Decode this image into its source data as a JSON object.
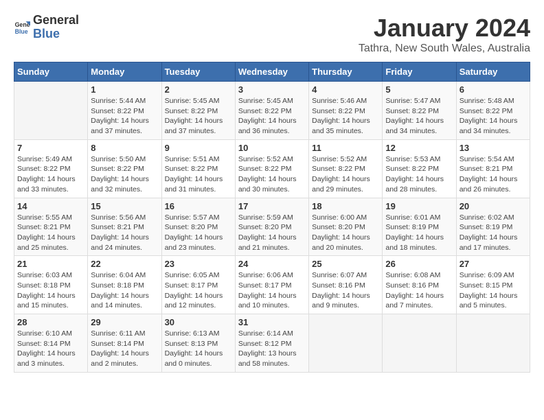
{
  "logo": {
    "line1": "General",
    "line2": "Blue"
  },
  "title": "January 2024",
  "subtitle": "Tathra, New South Wales, Australia",
  "days_of_week": [
    "Sunday",
    "Monday",
    "Tuesday",
    "Wednesday",
    "Thursday",
    "Friday",
    "Saturday"
  ],
  "weeks": [
    [
      {
        "day": "",
        "info": ""
      },
      {
        "day": "1",
        "info": "Sunrise: 5:44 AM\nSunset: 8:22 PM\nDaylight: 14 hours\nand 37 minutes."
      },
      {
        "day": "2",
        "info": "Sunrise: 5:45 AM\nSunset: 8:22 PM\nDaylight: 14 hours\nand 37 minutes."
      },
      {
        "day": "3",
        "info": "Sunrise: 5:45 AM\nSunset: 8:22 PM\nDaylight: 14 hours\nand 36 minutes."
      },
      {
        "day": "4",
        "info": "Sunrise: 5:46 AM\nSunset: 8:22 PM\nDaylight: 14 hours\nand 35 minutes."
      },
      {
        "day": "5",
        "info": "Sunrise: 5:47 AM\nSunset: 8:22 PM\nDaylight: 14 hours\nand 34 minutes."
      },
      {
        "day": "6",
        "info": "Sunrise: 5:48 AM\nSunset: 8:22 PM\nDaylight: 14 hours\nand 34 minutes."
      }
    ],
    [
      {
        "day": "7",
        "info": "Sunrise: 5:49 AM\nSunset: 8:22 PM\nDaylight: 14 hours\nand 33 minutes."
      },
      {
        "day": "8",
        "info": "Sunrise: 5:50 AM\nSunset: 8:22 PM\nDaylight: 14 hours\nand 32 minutes."
      },
      {
        "day": "9",
        "info": "Sunrise: 5:51 AM\nSunset: 8:22 PM\nDaylight: 14 hours\nand 31 minutes."
      },
      {
        "day": "10",
        "info": "Sunrise: 5:52 AM\nSunset: 8:22 PM\nDaylight: 14 hours\nand 30 minutes."
      },
      {
        "day": "11",
        "info": "Sunrise: 5:52 AM\nSunset: 8:22 PM\nDaylight: 14 hours\nand 29 minutes."
      },
      {
        "day": "12",
        "info": "Sunrise: 5:53 AM\nSunset: 8:22 PM\nDaylight: 14 hours\nand 28 minutes."
      },
      {
        "day": "13",
        "info": "Sunrise: 5:54 AM\nSunset: 8:21 PM\nDaylight: 14 hours\nand 26 minutes."
      }
    ],
    [
      {
        "day": "14",
        "info": "Sunrise: 5:55 AM\nSunset: 8:21 PM\nDaylight: 14 hours\nand 25 minutes."
      },
      {
        "day": "15",
        "info": "Sunrise: 5:56 AM\nSunset: 8:21 PM\nDaylight: 14 hours\nand 24 minutes."
      },
      {
        "day": "16",
        "info": "Sunrise: 5:57 AM\nSunset: 8:20 PM\nDaylight: 14 hours\nand 23 minutes."
      },
      {
        "day": "17",
        "info": "Sunrise: 5:59 AM\nSunset: 8:20 PM\nDaylight: 14 hours\nand 21 minutes."
      },
      {
        "day": "18",
        "info": "Sunrise: 6:00 AM\nSunset: 8:20 PM\nDaylight: 14 hours\nand 20 minutes."
      },
      {
        "day": "19",
        "info": "Sunrise: 6:01 AM\nSunset: 8:19 PM\nDaylight: 14 hours\nand 18 minutes."
      },
      {
        "day": "20",
        "info": "Sunrise: 6:02 AM\nSunset: 8:19 PM\nDaylight: 14 hours\nand 17 minutes."
      }
    ],
    [
      {
        "day": "21",
        "info": "Sunrise: 6:03 AM\nSunset: 8:18 PM\nDaylight: 14 hours\nand 15 minutes."
      },
      {
        "day": "22",
        "info": "Sunrise: 6:04 AM\nSunset: 8:18 PM\nDaylight: 14 hours\nand 14 minutes."
      },
      {
        "day": "23",
        "info": "Sunrise: 6:05 AM\nSunset: 8:17 PM\nDaylight: 14 hours\nand 12 minutes."
      },
      {
        "day": "24",
        "info": "Sunrise: 6:06 AM\nSunset: 8:17 PM\nDaylight: 14 hours\nand 10 minutes."
      },
      {
        "day": "25",
        "info": "Sunrise: 6:07 AM\nSunset: 8:16 PM\nDaylight: 14 hours\nand 9 minutes."
      },
      {
        "day": "26",
        "info": "Sunrise: 6:08 AM\nSunset: 8:16 PM\nDaylight: 14 hours\nand 7 minutes."
      },
      {
        "day": "27",
        "info": "Sunrise: 6:09 AM\nSunset: 8:15 PM\nDaylight: 14 hours\nand 5 minutes."
      }
    ],
    [
      {
        "day": "28",
        "info": "Sunrise: 6:10 AM\nSunset: 8:14 PM\nDaylight: 14 hours\nand 3 minutes."
      },
      {
        "day": "29",
        "info": "Sunrise: 6:11 AM\nSunset: 8:14 PM\nDaylight: 14 hours\nand 2 minutes."
      },
      {
        "day": "30",
        "info": "Sunrise: 6:13 AM\nSunset: 8:13 PM\nDaylight: 14 hours\nand 0 minutes."
      },
      {
        "day": "31",
        "info": "Sunrise: 6:14 AM\nSunset: 8:12 PM\nDaylight: 13 hours\nand 58 minutes."
      },
      {
        "day": "",
        "info": ""
      },
      {
        "day": "",
        "info": ""
      },
      {
        "day": "",
        "info": ""
      }
    ]
  ]
}
